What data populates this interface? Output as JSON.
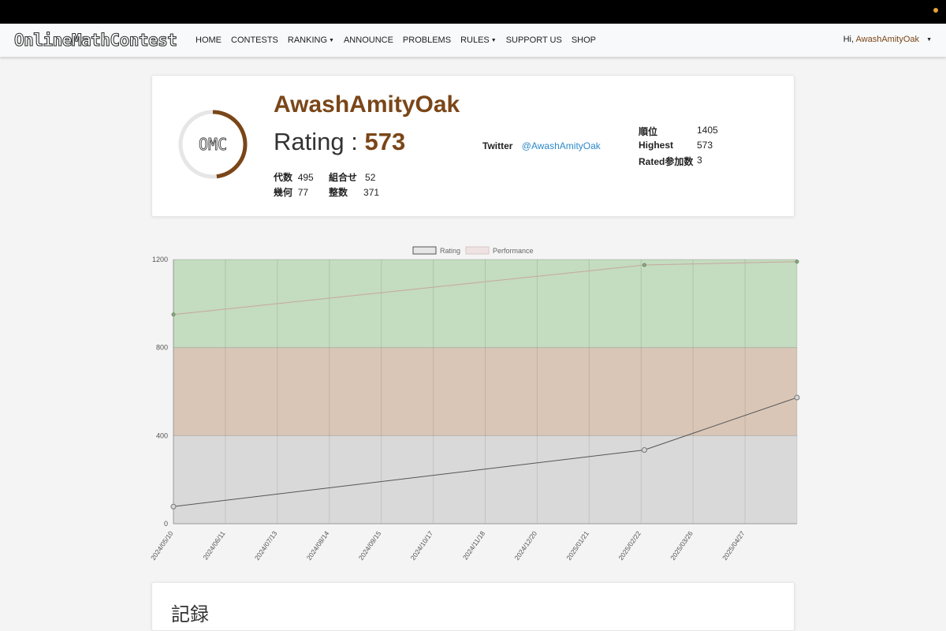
{
  "nav": {
    "brand": "OnlineMathContest",
    "items": [
      {
        "label": "HOME",
        "dropdown": false
      },
      {
        "label": "CONTESTS",
        "dropdown": false
      },
      {
        "label": "RANKING",
        "dropdown": true
      },
      {
        "label": "ANNOUNCE",
        "dropdown": false
      },
      {
        "label": "PROBLEMS",
        "dropdown": false
      },
      {
        "label": "RULES",
        "dropdown": true
      },
      {
        "label": "SUPPORT US",
        "dropdown": false
      },
      {
        "label": "SHOP",
        "dropdown": false
      }
    ],
    "greeting": "Hi,",
    "username": "AwashAmityOak"
  },
  "profile": {
    "logo_text": "OMC",
    "ring_fraction": 0.48,
    "name": "AwashAmityOak",
    "rating_label": "Rating :",
    "rating_value": "573",
    "genres": [
      {
        "label": "代数",
        "value": "495"
      },
      {
        "label": "組合せ",
        "value": "52"
      },
      {
        "label": "幾何",
        "value": "77"
      },
      {
        "label": "整数",
        "value": "371"
      }
    ],
    "twitter_label": "Twitter",
    "twitter_handle": "@AwashAmityOak",
    "stats": [
      {
        "label": "順位",
        "value": "1405"
      },
      {
        "label": "Highest",
        "value": "573"
      },
      {
        "label": "Rated参加数",
        "value": "3"
      }
    ]
  },
  "colors": {
    "brown": "#7a4618",
    "link": "#2d8ac9",
    "band_gray": "#d9d9d9",
    "band_brown": "#d9c6b7",
    "band_green": "#c4dcc0"
  },
  "chart_data": {
    "type": "line",
    "legend": [
      "Rating",
      "Performance"
    ],
    "legend_position": "top",
    "ylim": [
      0,
      1200
    ],
    "yticks": [
      0,
      400,
      800,
      1200
    ],
    "xticks": [
      "2024/05/10",
      "2024/06/11",
      "2024/07/13",
      "2024/08/14",
      "2024/09/15",
      "2024/10/17",
      "2024/11/18",
      "2024/12/20",
      "2025/01/21",
      "2025/02/22",
      "2025/03/26",
      "2025/04/27"
    ],
    "xlim": [
      "2024/05/10",
      "2025/05/29"
    ],
    "bands": [
      {
        "from": 0,
        "to": 400,
        "color": "#d9d9d9"
      },
      {
        "from": 400,
        "to": 800,
        "color": "#d9c6b7"
      },
      {
        "from": 800,
        "to": 1200,
        "color": "#c4dcc0"
      }
    ],
    "series": [
      {
        "name": "Rating",
        "x": [
          "2024/05/10",
          "2025/02/24",
          "2025/05/29"
        ],
        "values": [
          78,
          335,
          573
        ]
      },
      {
        "name": "Performance",
        "x": [
          "2024/05/10",
          "2025/02/24",
          "2025/05/29"
        ],
        "values": [
          950,
          1175,
          1190
        ]
      }
    ],
    "grid": true
  },
  "records": {
    "title": "記録"
  }
}
